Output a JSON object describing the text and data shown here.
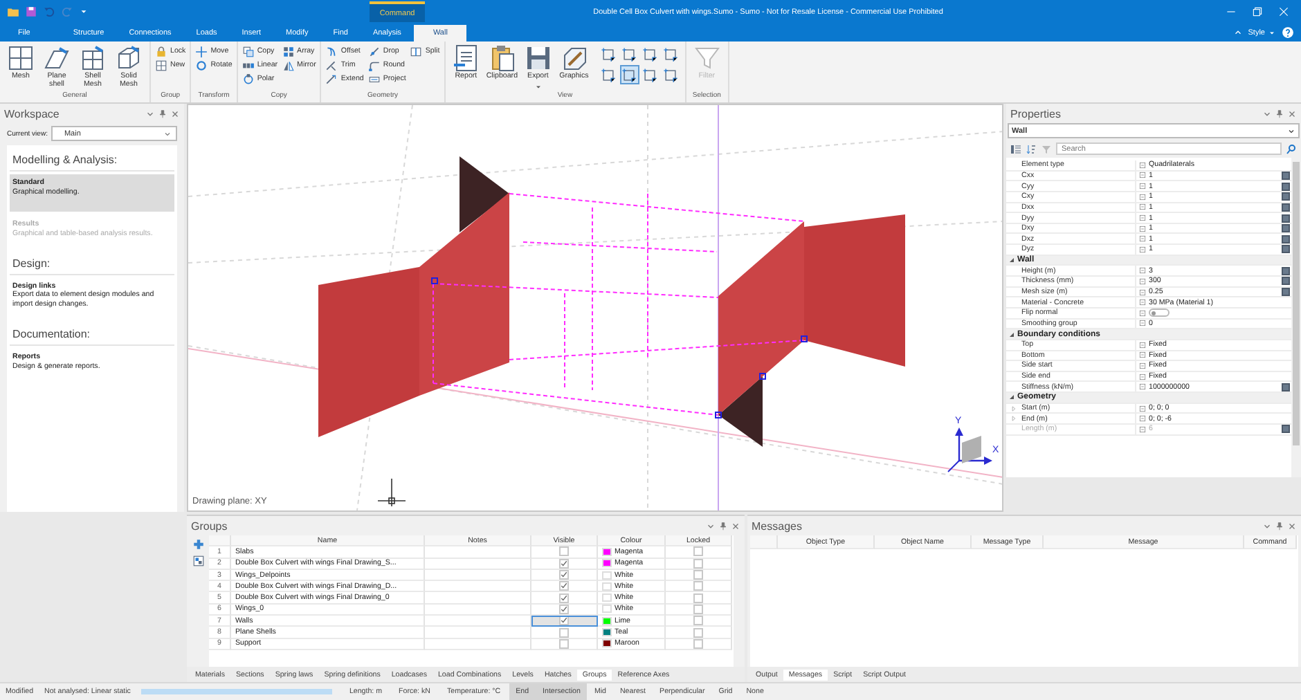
{
  "titlebar": {
    "title": "Double Cell Box Culvert with wings.Sumo - Sumo - Not for Resale License - Commercial Use Prohibited",
    "context_tab": "Command"
  },
  "menu_tabs": [
    {
      "label": "File",
      "selected": false
    },
    {
      "label": "Structure",
      "selected": false
    },
    {
      "label": "Connections",
      "selected": false
    },
    {
      "label": "Loads",
      "selected": false
    },
    {
      "label": "Insert",
      "selected": false
    },
    {
      "label": "Modify",
      "selected": false
    },
    {
      "label": "Find",
      "selected": false
    },
    {
      "label": "Analysis",
      "selected": false
    },
    {
      "label": "Wall",
      "selected": true
    }
  ],
  "style_menu": "Style",
  "ribbon": {
    "groups": [
      {
        "label": "General",
        "buttons": [
          {
            "kind": "large",
            "label": "Mesh",
            "disabled": false,
            "dropdown": false
          },
          {
            "kind": "large",
            "label": "Plane shell",
            "disabled": false,
            "dropdown": false
          },
          {
            "kind": "large",
            "label": "Shell Mesh",
            "disabled": false,
            "dropdown": false
          },
          {
            "kind": "large",
            "label": "Solid Mesh",
            "disabled": false,
            "dropdown": false
          }
        ]
      },
      {
        "label": "Group",
        "buttons": [
          {
            "kind": "small",
            "label": "Lock",
            "disabled": false
          },
          {
            "kind": "small",
            "label": "New",
            "disabled": false
          }
        ]
      },
      {
        "label": "Transform",
        "buttons": [
          {
            "kind": "small",
            "label": "Move",
            "disabled": false
          },
          {
            "kind": "small",
            "label": "Rotate",
            "disabled": false
          }
        ]
      },
      {
        "label": "Copy",
        "buttons": [
          {
            "kind": "small",
            "label": "Copy",
            "disabled": false
          },
          {
            "kind": "small",
            "label": "Linear",
            "disabled": false
          },
          {
            "kind": "small",
            "label": "Polar",
            "disabled": false
          },
          {
            "kind": "small",
            "label": "Array",
            "disabled": false
          },
          {
            "kind": "small",
            "label": "Mirror",
            "disabled": false
          }
        ]
      },
      {
        "label": "Geometry",
        "buttons": [
          {
            "kind": "small",
            "label": "Offset",
            "disabled": false
          },
          {
            "kind": "small",
            "label": "Trim",
            "disabled": false
          },
          {
            "kind": "small",
            "label": "Extend",
            "disabled": false
          },
          {
            "kind": "small",
            "label": "Drop",
            "disabled": false
          },
          {
            "kind": "small",
            "label": "Round",
            "disabled": false
          },
          {
            "kind": "small",
            "label": "Project",
            "disabled": false
          },
          {
            "kind": "small",
            "label": "Split",
            "disabled": false
          }
        ]
      },
      {
        "label": "View",
        "buttons": [
          {
            "kind": "large",
            "label": "Report",
            "disabled": false,
            "dropdown": false
          },
          {
            "kind": "large",
            "label": "Clipboard",
            "disabled": false,
            "dropdown": false
          },
          {
            "kind": "large",
            "label": "Export",
            "disabled": false,
            "dropdown": true
          },
          {
            "kind": "large",
            "label": "Graphics",
            "disabled": false,
            "dropdown": false
          },
          {
            "kind": "icon",
            "selected": false
          },
          {
            "kind": "icon",
            "selected": false
          },
          {
            "kind": "icon",
            "selected": false
          },
          {
            "kind": "icon",
            "selected": true
          },
          {
            "kind": "icon",
            "selected": false
          },
          {
            "kind": "icon",
            "selected": false
          },
          {
            "kind": "icon",
            "selected": false
          },
          {
            "kind": "icon",
            "selected": false
          }
        ]
      },
      {
        "label": "Selection",
        "buttons": [
          {
            "kind": "large",
            "label": "Filter",
            "disabled": true,
            "dropdown": false
          }
        ]
      }
    ]
  },
  "workspace": {
    "title": "Workspace",
    "current_view_label": "Current view:",
    "current_view": "Main",
    "sections": [
      {
        "heading": "Modelling & Analysis:",
        "items": [
          {
            "title": "Standard",
            "description": "Graphical modelling.",
            "selected": true,
            "disabled": false
          },
          {
            "title": "Results",
            "description": "Graphical and table-based analysis results.",
            "selected": false,
            "disabled": true
          }
        ]
      },
      {
        "heading": "Design:",
        "items": [
          {
            "title": "Design links",
            "description": "Export data to element design modules and import design changes.",
            "selected": false,
            "disabled": false
          }
        ]
      },
      {
        "heading": "Documentation:",
        "items": [
          {
            "title": "Reports",
            "description": "Design & generate reports.",
            "selected": false,
            "disabled": false
          }
        ]
      }
    ]
  },
  "viewport": {
    "drawing_plane": "Drawing plane: XY",
    "axis_labels": [
      "Y",
      "X"
    ]
  },
  "properties": {
    "title": "Properties",
    "object": "Wall",
    "search_placeholder": "Search",
    "sections": [
      {
        "rows": [
          {
            "name": "Element type",
            "value": "Quadrilaterals",
            "button": false
          },
          {
            "name": "Cxx",
            "value": "1",
            "button": true
          },
          {
            "name": "Cyy",
            "value": "1",
            "button": true
          },
          {
            "name": "Cxy",
            "value": "1",
            "button": true
          },
          {
            "name": "Dxx",
            "value": "1",
            "button": true
          },
          {
            "name": "Dyy",
            "value": "1",
            "button": true
          },
          {
            "name": "Dxy",
            "value": "1",
            "button": true
          },
          {
            "name": "Dxz",
            "value": "1",
            "button": true
          },
          {
            "name": "Dyz",
            "value": "1",
            "button": true
          }
        ]
      },
      {
        "title": "Wall",
        "expanded": true,
        "rows": [
          {
            "name": "Height (m)",
            "value": "3",
            "button": true
          },
          {
            "name": "Thickness (mm)",
            "value": "300",
            "button": true
          },
          {
            "name": "Mesh size (m)",
            "value": "0.25",
            "button": true
          },
          {
            "name": "Material - Concrete",
            "value": "30 MPa (Material 1)",
            "button": false
          },
          {
            "name": "Flip normal",
            "kind": "toggle",
            "on": false,
            "button": false
          },
          {
            "name": "Smoothing group",
            "value": "0",
            "button": false
          }
        ]
      },
      {
        "title": "Boundary conditions",
        "expanded": true,
        "rows": [
          {
            "name": "Top",
            "value": "Fixed",
            "button": false
          },
          {
            "name": "Bottom",
            "value": "Fixed",
            "button": false
          },
          {
            "name": "Side start",
            "value": "Fixed",
            "button": false
          },
          {
            "name": "Side end",
            "value": "Fixed",
            "button": false
          },
          {
            "name": "Stiffness (kN/m)",
            "value": "1000000000",
            "button": true
          }
        ]
      },
      {
        "title": "Geometry",
        "expanded": true,
        "rows": [
          {
            "name": "Start (m)",
            "value": "0; 0; 0",
            "button": false,
            "expandable": true
          },
          {
            "name": "End (m)",
            "value": "0; 0; -6",
            "button": false,
            "expandable": true
          },
          {
            "name": "Length (m)",
            "value": "6",
            "button": true,
            "disabled": true
          }
        ]
      }
    ]
  },
  "groups_panel": {
    "title": "Groups",
    "columns": [
      "Name",
      "Notes",
      "Visible",
      "Colour",
      "Locked"
    ],
    "rows": [
      {
        "index": "1",
        "name": "Slabs",
        "visible": false,
        "colour": "Magenta",
        "color": "#ff00ff",
        "locked": false,
        "selected": false
      },
      {
        "index": "2",
        "name": "Double Box Culvert with wings Final Drawing_S...",
        "visible": true,
        "colour": "Magenta",
        "color": "#ff00ff",
        "locked": false,
        "selected": false
      },
      {
        "index": "3",
        "name": "Wings_Delpoints",
        "visible": true,
        "colour": "White",
        "color": "#ffffff",
        "locked": false,
        "selected": false
      },
      {
        "index": "4",
        "name": "Double Box Culvert with wings Final Drawing_D...",
        "visible": true,
        "colour": "White",
        "color": "#ffffff",
        "locked": false,
        "selected": false
      },
      {
        "index": "5",
        "name": "Double Box Culvert with wings Final Drawing_0",
        "visible": true,
        "colour": "White",
        "color": "#ffffff",
        "locked": false,
        "selected": false
      },
      {
        "index": "6",
        "name": "Wings_0",
        "visible": true,
        "colour": "White",
        "color": "#ffffff",
        "locked": false,
        "selected": false
      },
      {
        "index": "7",
        "name": "Walls",
        "visible": true,
        "colour": "Lime",
        "color": "#00ff00",
        "locked": false,
        "selected": true
      },
      {
        "index": "8",
        "name": "Plane Shells",
        "visible": false,
        "colour": "Teal",
        "color": "#008080",
        "locked": false,
        "selected": false
      },
      {
        "index": "9",
        "name": "Support",
        "visible": false,
        "colour": "Maroon",
        "color": "#800000",
        "locked": false,
        "selected": false
      }
    ]
  },
  "left_tabs": [
    {
      "label": "Materials",
      "selected": false
    },
    {
      "label": "Sections",
      "selected": false
    },
    {
      "label": "Spring laws",
      "selected": false
    },
    {
      "label": "Spring definitions",
      "selected": false
    },
    {
      "label": "Loadcases",
      "selected": false
    },
    {
      "label": "Load Combinations",
      "selected": false
    },
    {
      "label": "Levels",
      "selected": false
    },
    {
      "label": "Hatches",
      "selected": false
    },
    {
      "label": "Groups",
      "selected": true
    },
    {
      "label": "Reference Axes",
      "selected": false
    }
  ],
  "messages": {
    "title": "Messages",
    "columns": [
      "Object Type",
      "Object Name",
      "Message Type",
      "Message",
      "Command"
    ]
  },
  "right_tabs": [
    {
      "label": "Output",
      "selected": false
    },
    {
      "label": "Messages",
      "selected": true
    },
    {
      "label": "Script",
      "selected": false
    },
    {
      "label": "Script Output",
      "selected": false
    }
  ],
  "status_bar": {
    "items": [
      "Modified",
      "Not analysed: Linear static"
    ],
    "progress": {
      "level": 1
    },
    "units": [
      "Length: m",
      "Force: kN",
      "Temperature: °C"
    ],
    "snaps": [
      {
        "label": "End",
        "on": true
      },
      {
        "label": "Intersection",
        "on": true
      },
      {
        "label": "Mid",
        "on": false
      },
      {
        "label": "Nearest",
        "on": false
      },
      {
        "label": "Perpendicular",
        "on": false
      },
      {
        "label": "Grid",
        "on": false
      },
      {
        "label": "None",
        "on": false
      }
    ]
  }
}
